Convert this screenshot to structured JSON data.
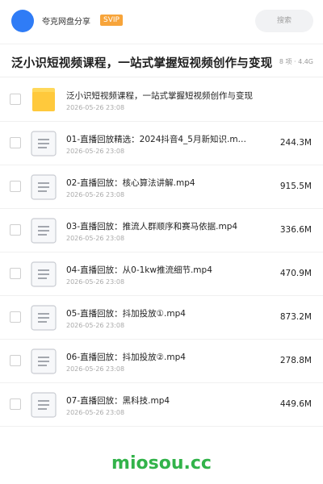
{
  "header": {
    "app_name": "夸克网盘分享",
    "badge": "SVIP",
    "search_placeholder": "搜索"
  },
  "title_bar": {
    "title": "泛小识短视频课程，一站式掌握短视频创作与变现",
    "meta": "8 项 · 4.4G"
  },
  "items": [
    {
      "type": "folder",
      "name": "泛小识短视频课程，一站式掌握短视频创作与变现",
      "date": "2026-05-26 23:08",
      "size": ""
    },
    {
      "type": "file",
      "name": "01-直播回放精选：2024抖音4_5月新知识.m…",
      "date": "2026-05-26 23:08",
      "size": "244.3M"
    },
    {
      "type": "file",
      "name": "02-直播回放：核心算法讲解.mp4",
      "date": "2026-05-26 23:08",
      "size": "915.5M"
    },
    {
      "type": "file",
      "name": "03-直播回放：推流人群顺序和赛马依据.mp4",
      "date": "2026-05-26 23:08",
      "size": "336.6M"
    },
    {
      "type": "file",
      "name": "04-直播回放：从0-1kw推流细节.mp4",
      "date": "2026-05-26 23:08",
      "size": "470.9M"
    },
    {
      "type": "file",
      "name": "05-直播回放：抖加投放①.mp4",
      "date": "2026-05-26 23:08",
      "size": "873.2M"
    },
    {
      "type": "file",
      "name": "06-直播回放：抖加投放②.mp4",
      "date": "2026-05-26 23:08",
      "size": "278.8M"
    },
    {
      "type": "file",
      "name": "07-直播回放：黑科技.mp4",
      "date": "2026-05-26 23:08",
      "size": "449.6M"
    }
  ],
  "watermark": "miosou.cc",
  "colors": {
    "accent": "#2f7cf6",
    "badge": "#f7a43a",
    "folder": "#ffc93c",
    "watermark": "#32b34a"
  }
}
